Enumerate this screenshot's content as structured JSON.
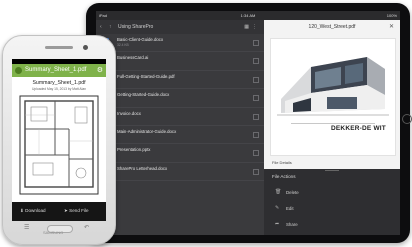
{
  "tablet": {
    "status": {
      "left": "iPad",
      "time": "1:34 AM",
      "battery": "100%"
    },
    "toolbar": {
      "title": "Using SharePro"
    },
    "files": [
      {
        "name": "Basic-Client-Guide.docx",
        "meta": "32.4 KB",
        "color": "#3a6fbf"
      },
      {
        "name": "BusinessCard.ai",
        "meta": "",
        "color": "#c44a2a"
      },
      {
        "name": "Full-Getting-Started-Guide.pdf",
        "meta": "",
        "color": "#c62828"
      },
      {
        "name": "Getting-Started-Guide.docx",
        "meta": "",
        "color": "#3a6fbf"
      },
      {
        "name": "Invoice.docx",
        "meta": "",
        "color": "#3a6fbf"
      },
      {
        "name": "Main-Administrator-Guide.docx",
        "meta": "",
        "color": "#3a6fbf"
      },
      {
        "name": "Presentation.pptx",
        "meta": "",
        "color": "#d8692a"
      },
      {
        "name": "SharePro Letterhead.docx",
        "meta": "",
        "color": "#3a6fbf"
      }
    ],
    "preview": {
      "filename": "120_West_Street.pdf",
      "brand": "DEKKER-DE WIT",
      "details_label": "File Details"
    },
    "actions": {
      "header": "File Actions",
      "items": [
        {
          "icon": "trash-icon",
          "label": "Delete"
        },
        {
          "icon": "pencil-icon",
          "label": "Edit"
        },
        {
          "icon": "share-icon",
          "label": "Share"
        }
      ]
    }
  },
  "phone": {
    "brand": "SAMSUNG",
    "app_title": "Summary_Sheet_1.pdf",
    "doc_title": "Summary_Sheet_1.pdf",
    "doc_subtitle": "Uploaded May 15, 2013 by Matt Alan",
    "bottom": {
      "download": "Download",
      "send": "Send File"
    },
    "accent": "#7fb24a"
  }
}
